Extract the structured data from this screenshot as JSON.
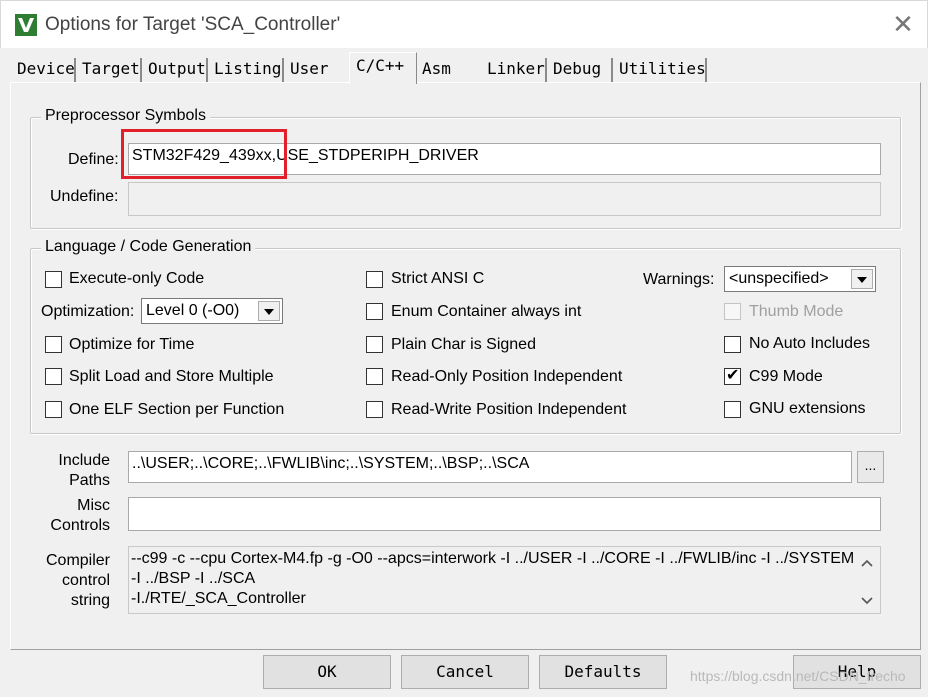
{
  "window": {
    "title": "Options for Target 'SCA_Controller'",
    "app_icon": "keil-uvision-icon",
    "close_glyph": "✕"
  },
  "tabs": [
    {
      "label": "Device",
      "active": false
    },
    {
      "label": "Target",
      "active": false
    },
    {
      "label": "Output",
      "active": false
    },
    {
      "label": "Listing",
      "active": false
    },
    {
      "label": "User",
      "active": false
    },
    {
      "label": "C/C++",
      "active": true
    },
    {
      "label": "Asm",
      "active": false
    },
    {
      "label": "Linker",
      "active": false
    },
    {
      "label": "Debug",
      "active": false
    },
    {
      "label": "Utilities",
      "active": false
    }
  ],
  "preprocessor": {
    "group_title": "Preprocessor Symbols",
    "define_label": "Define:",
    "define_value": "STM32F429_439xx,USE_STDPERIPH_DRIVER",
    "undefine_label": "Undefine:",
    "undefine_value": ""
  },
  "codegen": {
    "group_title": "Language / Code Generation",
    "execute_only": {
      "label": "Execute-only Code",
      "checked": false
    },
    "optimization_label": "Optimization:",
    "optimization_value": "Level 0 (-O0)",
    "optimize_time": {
      "label": "Optimize for Time",
      "checked": false
    },
    "split_load": {
      "label": "Split Load and Store Multiple",
      "checked": false
    },
    "one_elf": {
      "label": "One ELF Section per Function",
      "checked": false
    },
    "strict_ansi": {
      "label": "Strict ANSI C",
      "checked": false
    },
    "enum_container": {
      "label": "Enum Container always int",
      "checked": false
    },
    "plain_char": {
      "label": "Plain Char is Signed",
      "checked": false
    },
    "ro_pi": {
      "label": "Read-Only Position Independent",
      "checked": false
    },
    "rw_pi": {
      "label": "Read-Write Position Independent",
      "checked": false
    },
    "warnings_label": "Warnings:",
    "warnings_value": "<unspecified>",
    "thumb_mode": {
      "label": "Thumb Mode",
      "checked": false,
      "disabled": true
    },
    "no_auto_includes": {
      "label": "No Auto Includes",
      "checked": false
    },
    "c99_mode": {
      "label": "C99 Mode",
      "checked": true
    },
    "gnu_extensions": {
      "label": "GNU extensions",
      "checked": false
    }
  },
  "include": {
    "label_line1": "Include",
    "label_line2": "Paths",
    "value": "..\\USER;..\\CORE;..\\FWLIB\\inc;..\\SYSTEM;..\\BSP;..\\SCA",
    "browse_label": "..."
  },
  "misc": {
    "label_line1": "Misc",
    "label_line2": "Controls",
    "value": ""
  },
  "compiler": {
    "label_line1": "Compiler",
    "label_line2": "control",
    "label_line3": "string",
    "line1": "--c99 -c --cpu Cortex-M4.fp -g -O0 --apcs=interwork -I ../USER -I ../CORE -I ../FWLIB/inc -I ../SYSTEM",
    "line2": "-I ../BSP -I ../SCA",
    "line3": "-I./RTE/_SCA_Controller"
  },
  "buttons": {
    "ok": "OK",
    "cancel": "Cancel",
    "defaults": "Defaults",
    "help": "Help"
  },
  "watermark": "https://blog.csdn.net/CSDN_frecho",
  "colors": {
    "highlight_box": "#e1202b",
    "dialog_bg": "#f0f0f0"
  }
}
